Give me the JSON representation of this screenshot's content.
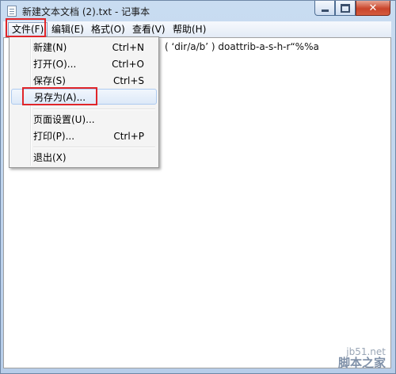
{
  "window": {
    "title": "新建文本文档 (2).txt - 记事本",
    "icon": "notepad-icon",
    "caption_glyphs": {
      "minimize": "—",
      "maximize": "□",
      "close": "✕"
    }
  },
  "menubar": {
    "items": [
      {
        "label": "文件(F)"
      },
      {
        "label": "编辑(E)"
      },
      {
        "label": "格式(O)"
      },
      {
        "label": "查看(V)"
      },
      {
        "label": "帮助(H)"
      }
    ]
  },
  "editor": {
    "visible_text": "( ‘dir/a/b’ ) doattrib-a-s-h-r“%%a"
  },
  "file_menu": {
    "items": [
      {
        "label": "新建(N)",
        "shortcut": "Ctrl+N"
      },
      {
        "label": "打开(O)...",
        "shortcut": "Ctrl+O"
      },
      {
        "label": "保存(S)",
        "shortcut": "Ctrl+S"
      },
      {
        "label": "另存为(A)...",
        "shortcut": ""
      },
      {
        "label": "页面设置(U)...",
        "shortcut": ""
      },
      {
        "label": "打印(P)...",
        "shortcut": "Ctrl+P"
      },
      {
        "label": "退出(X)",
        "shortcut": ""
      }
    ],
    "highlighted_item": "另存为(A)..."
  },
  "annotations": {
    "highlight_color": "#e0262a"
  },
  "watermark": {
    "line1": "jb51.net",
    "line2": "脚本之家"
  }
}
